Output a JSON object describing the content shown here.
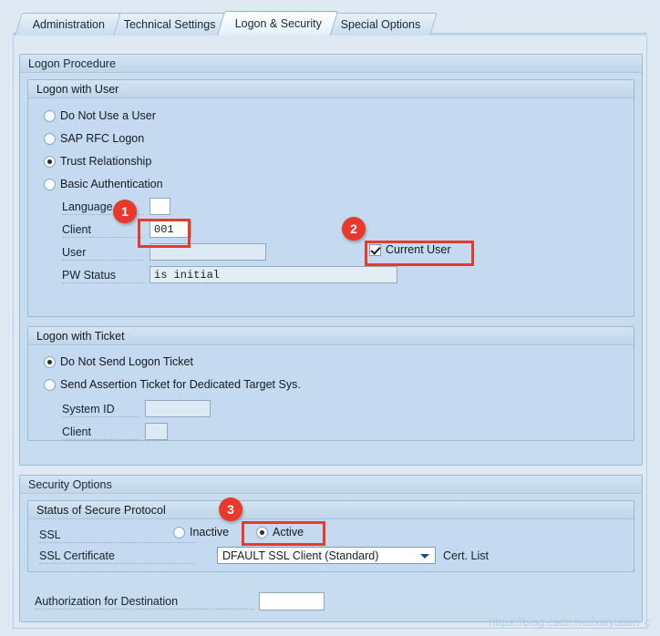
{
  "window": {
    "watermark": "https://blog.csdn.net/xiayutian_c"
  },
  "tabs": [
    {
      "label": "Administration",
      "active": false
    },
    {
      "label": "Technical Settings",
      "active": false
    },
    {
      "label": "Logon & Security",
      "active": true
    },
    {
      "label": "Special Options",
      "active": false
    }
  ],
  "logon_procedure": {
    "title": "Logon Procedure",
    "logon_with_user": {
      "title": "Logon with User",
      "radios": [
        {
          "label": "Do Not Use a User",
          "selected": false
        },
        {
          "label": "SAP RFC Logon",
          "selected": false
        },
        {
          "label": "Trust Relationship",
          "selected": true
        },
        {
          "label": "Basic Authentication",
          "selected": false
        }
      ],
      "fields": [
        {
          "label": "Language",
          "value": ""
        },
        {
          "label": "Client",
          "value": "001"
        },
        {
          "label": "User",
          "value": ""
        },
        {
          "label": "PW Status",
          "value": "is initial"
        }
      ],
      "current_user": {
        "label": "Current User",
        "checked": true
      }
    },
    "logon_with_ticket": {
      "title": "Logon with Ticket",
      "radios": [
        {
          "label": "Do Not Send Logon Ticket",
          "selected": true
        },
        {
          "label": "Send Assertion Ticket for Dedicated Target Sys.",
          "selected": false
        }
      ],
      "fields": [
        {
          "label": "System ID",
          "value": ""
        },
        {
          "label": "Client",
          "value": ""
        }
      ]
    }
  },
  "security_options": {
    "title": "Security Options",
    "status_of_secure_protocol": {
      "title": "Status of Secure Protocol",
      "ssl_label": "SSL",
      "ssl_radios": [
        {
          "label": "Inactive",
          "selected": false
        },
        {
          "label": "Active",
          "selected": true
        }
      ],
      "ssl_certificate_label": "SSL Certificate",
      "ssl_certificate_value": "DFAULT SSL Client (Standard)",
      "cert_list_label": "Cert. List"
    },
    "authorization_label": "Authorization for Destination",
    "authorization_value": ""
  },
  "annotations": [
    {
      "number": "1"
    },
    {
      "number": "2"
    },
    {
      "number": "3"
    }
  ]
}
